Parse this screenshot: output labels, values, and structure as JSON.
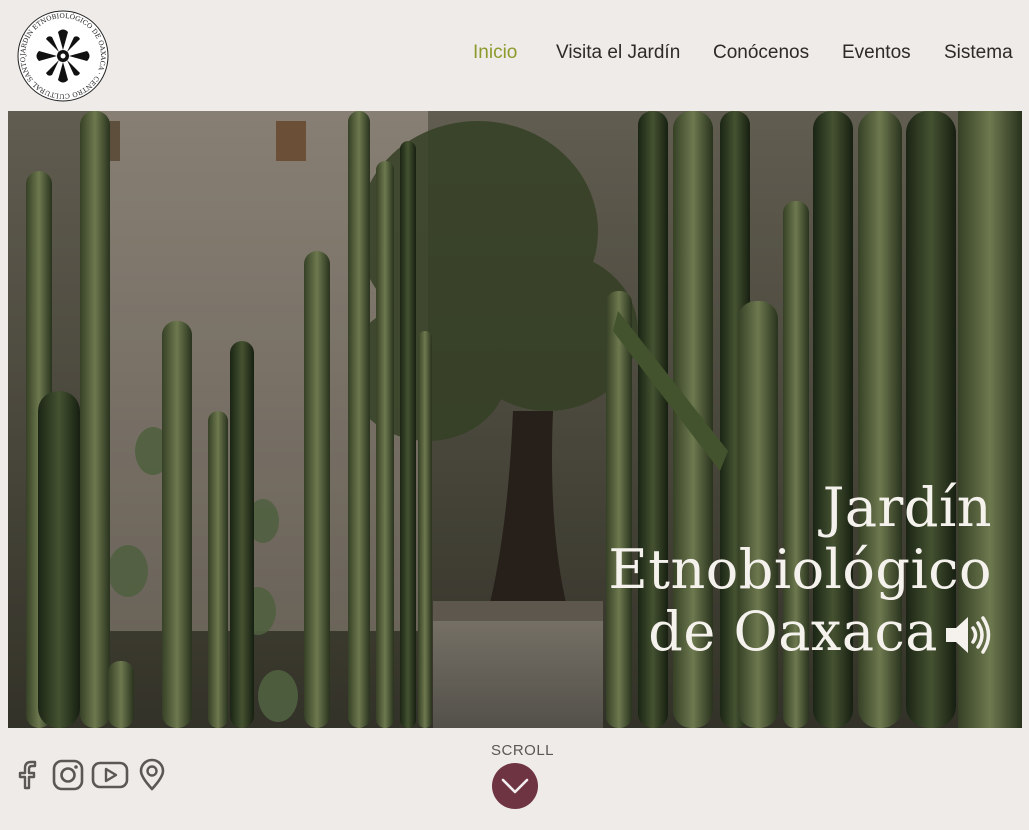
{
  "logo": {
    "ring_text": "JARDÍN ETNOBIOLÓGICO DE OAXACA · CENTRO CULTURAL SANTO DOMINGO",
    "icon": "garden-emblem-icon"
  },
  "nav": {
    "items": [
      {
        "label": "Inicio",
        "active": true
      },
      {
        "label": "Visita el Jardín",
        "active": false
      },
      {
        "label": "Conócenos",
        "active": false
      },
      {
        "label": "Eventos",
        "active": false
      },
      {
        "label": "Sistema",
        "active": false
      }
    ]
  },
  "hero": {
    "title_line1": "Jardín",
    "title_line2": "Etnobiológico",
    "title_line3": "de Oaxaca",
    "audio_icon": "speaker-icon"
  },
  "social": {
    "icons": [
      "facebook-icon",
      "instagram-icon",
      "youtube-icon",
      "location-pin-icon"
    ]
  },
  "scroll": {
    "label": "SCROLL",
    "icon": "chevron-down-icon"
  },
  "colors": {
    "background": "#eeebe8",
    "nav_active": "#8d9a2c",
    "nav_text": "#2d2a27",
    "scroll_button": "#6e3441",
    "hero_text": "#f5f2ed",
    "social_icon": "#5b5754"
  }
}
